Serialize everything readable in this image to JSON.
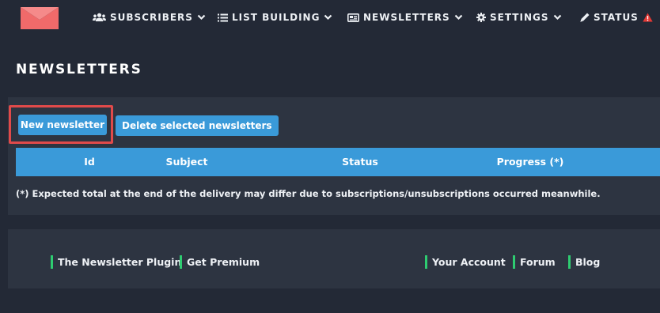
{
  "brand": {
    "accent": "#f06a6a",
    "primary": "#3a9ad9",
    "background": "#232936",
    "panel": "#2d3441",
    "highlight_border": "#e04a4a",
    "footer_bar": "#2ecc71",
    "warning": "#e53935"
  },
  "nav": {
    "subscribers": {
      "label": "SUBSCRIBERS",
      "icon": "users-icon"
    },
    "list_building": {
      "label": "LIST BUILDING",
      "icon": "list-icon"
    },
    "newsletters": {
      "label": "NEWSLETTERS",
      "icon": "newspaper-icon"
    },
    "settings": {
      "label": "SETTINGS",
      "icon": "gear-icon"
    },
    "status": {
      "label": "STATUS",
      "icon": "pen-icon",
      "alert_icon": "warning-icon"
    }
  },
  "page": {
    "title": "NEWSLETTERS"
  },
  "actions": {
    "new_label": "New newsletter",
    "delete_label": "Delete selected newsletters"
  },
  "table": {
    "columns": [
      "Id",
      "Subject",
      "Status",
      "Progress (*)"
    ],
    "rows": []
  },
  "note": "(*) Expected total at the end of the delivery may differ due to subscriptions/unsubscriptions occurred meanwhile.",
  "footer": {
    "links": [
      "The Newsletter Plugin",
      "Get Premium",
      "Your Account",
      "Forum",
      "Blog"
    ]
  }
}
